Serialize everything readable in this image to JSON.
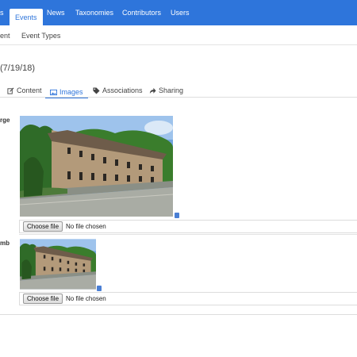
{
  "topnav": {
    "items": [
      "s",
      "Events",
      "News",
      "Taxonomies",
      "Contributors",
      "Users"
    ],
    "active": "Events"
  },
  "subnav": {
    "items": [
      "ent",
      "Event Types"
    ]
  },
  "page_title": "(7/19/18)",
  "tabs": [
    {
      "label": "Content",
      "icon": "edit-icon"
    },
    {
      "label": "Images",
      "icon": "image-icon",
      "active": true
    },
    {
      "label": "Associations",
      "icon": "tags-icon"
    },
    {
      "label": "Sharing",
      "icon": "share-icon"
    }
  ],
  "fields": {
    "large": {
      "label": "rge",
      "button": "Choose file",
      "status": "No file chosen"
    },
    "thumb": {
      "label": "mb",
      "button": "Choose file",
      "status": "No file chosen"
    }
  },
  "colors": {
    "brand": "#2e75db"
  }
}
